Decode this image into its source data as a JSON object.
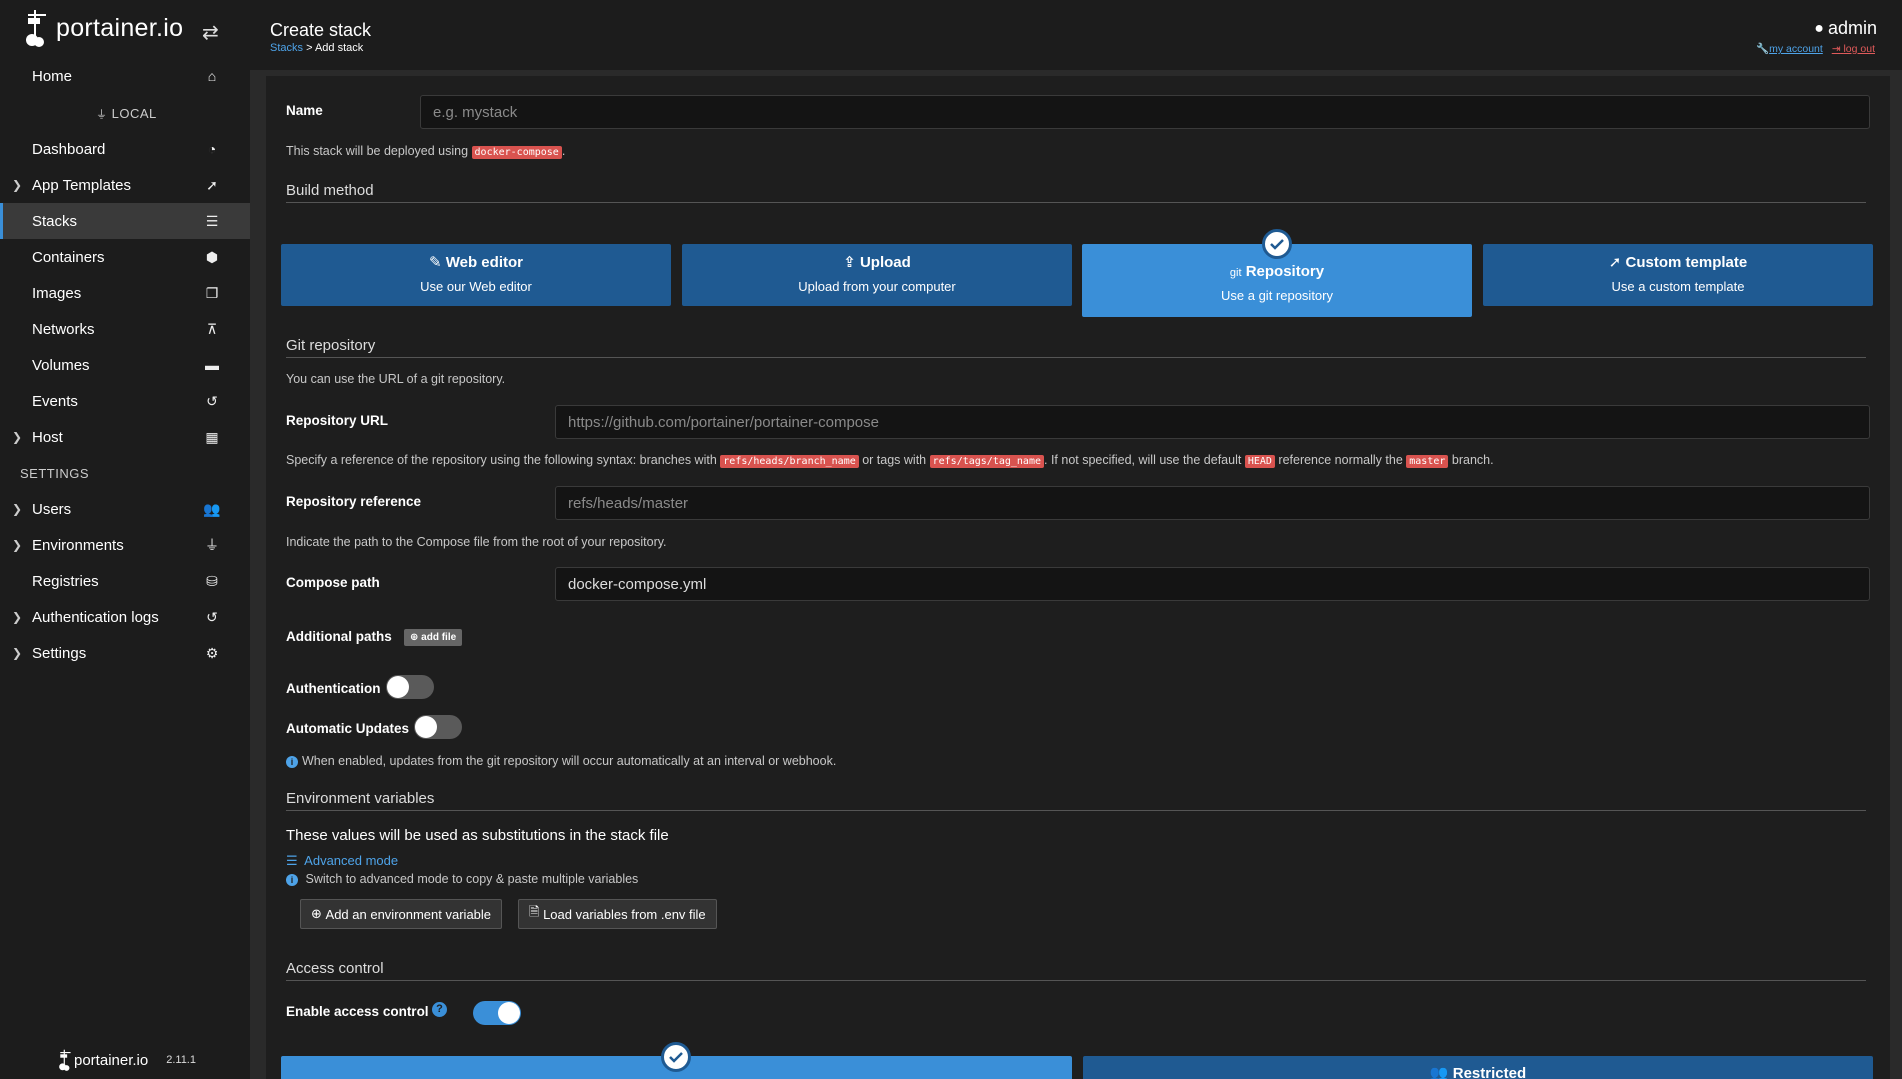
{
  "app": {
    "name": "portainer.io",
    "version": "2.11.1"
  },
  "sidebar": {
    "environment_label": "LOCAL",
    "settings_label": "SETTINGS",
    "items": [
      {
        "label": "Home",
        "icon": "home-icon"
      },
      {
        "label": "Dashboard",
        "icon": "tachometer-icon"
      },
      {
        "label": "App Templates",
        "icon": "rocket-icon"
      },
      {
        "label": "Stacks",
        "icon": "th-list-icon"
      },
      {
        "label": "Containers",
        "icon": "cubes-icon"
      },
      {
        "label": "Images",
        "icon": "clone-icon"
      },
      {
        "label": "Networks",
        "icon": "sitemap-icon"
      },
      {
        "label": "Volumes",
        "icon": "hdd-icon"
      },
      {
        "label": "Events",
        "icon": "history-icon"
      },
      {
        "label": "Host",
        "icon": "th-icon"
      },
      {
        "label": "Users",
        "icon": "users-icon"
      },
      {
        "label": "Environments",
        "icon": "plug-icon"
      },
      {
        "label": "Registries",
        "icon": "database-icon"
      },
      {
        "label": "Authentication logs",
        "icon": "history-icon"
      },
      {
        "label": "Settings",
        "icon": "cogs-icon"
      }
    ]
  },
  "header": {
    "title": "Create stack",
    "breadcrumb_link": "Stacks",
    "breadcrumb_current": "> Add stack",
    "user": "admin",
    "my_account": "my account",
    "log_out": "log out"
  },
  "form": {
    "name_label": "Name",
    "name_placeholder": "e.g. mystack",
    "deploy_note_prefix": "This stack will be deployed using",
    "deploy_note_code": "docker-compose",
    "deploy_note_suffix": ".",
    "build_method_title": "Build method",
    "build_methods": [
      {
        "title": "Web editor",
        "subtitle": "Use our Web editor",
        "icon": "edit-icon"
      },
      {
        "title": "Upload",
        "subtitle": "Upload from your computer",
        "icon": "upload-icon"
      },
      {
        "title": "Repository",
        "subtitle": "Use a git repository",
        "icon": "git-icon",
        "prefix": "git"
      },
      {
        "title": "Custom template",
        "subtitle": "Use a custom template",
        "icon": "rocket-icon"
      }
    ],
    "git_title": "Git repository",
    "git_help": "You can use the URL of a git repository.",
    "repo_url_label": "Repository URL",
    "repo_url_placeholder": "https://github.com/portainer/portainer-compose",
    "ref_help_1": "Specify a reference of the repository using the following syntax: branches with",
    "ref_code_1": "refs/heads/branch_name",
    "ref_help_2": "or tags with",
    "ref_code_2": "refs/tags/tag_name",
    "ref_help_3": ". If not specified, will use the default",
    "ref_code_3": "HEAD",
    "ref_help_4": "reference normally the",
    "ref_code_4": "master",
    "ref_help_5": "branch.",
    "repo_ref_label": "Repository reference",
    "repo_ref_placeholder": "refs/heads/master",
    "compose_help": "Indicate the path to the Compose file from the root of your repository.",
    "compose_label": "Compose path",
    "compose_value": "docker-compose.yml",
    "additional_paths_label": "Additional paths",
    "add_file_label": "add file",
    "auth_label": "Authentication",
    "auto_updates_label": "Automatic Updates",
    "auto_updates_help": "When enabled, updates from the git repository will occur automatically at an interval or webhook.",
    "env_title": "Environment variables",
    "env_subtitle": "These values will be used as substitutions in the stack file",
    "advanced_mode": "Advanced mode",
    "advanced_help": "Switch to advanced mode to copy & paste multiple variables",
    "add_env_button": "Add an environment variable",
    "load_env_button": "Load variables from .env file",
    "access_title": "Access control",
    "enable_access_label": "Enable access control",
    "restricted_label": "Restricted"
  },
  "colors": {
    "accent": "#3a8fd8",
    "primary_dark": "#1f5a92",
    "danger": "#d9534f"
  }
}
